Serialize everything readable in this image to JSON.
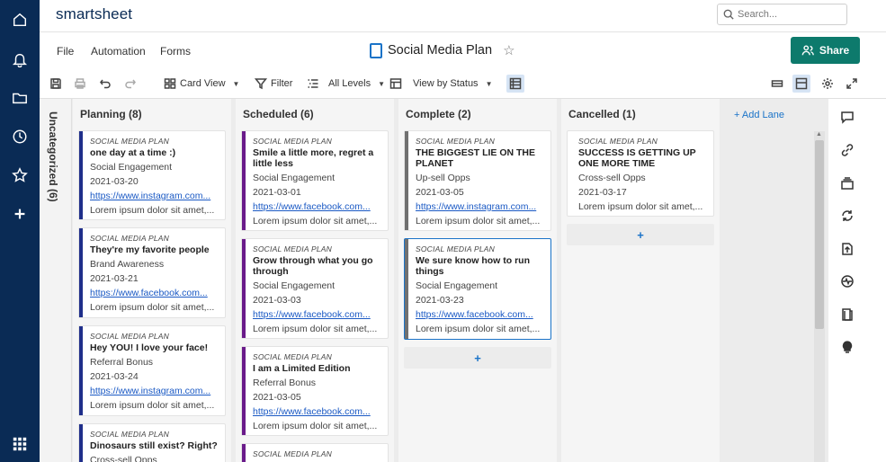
{
  "app": {
    "logo": "smartsheet",
    "search_placeholder": "Search..."
  },
  "menu": {
    "file": "File",
    "automation": "Automation",
    "forms": "Forms"
  },
  "sheet": {
    "title": "Social Media Plan"
  },
  "share_label": "Share",
  "toolbar": {
    "card_view": "Card View",
    "filter": "Filter",
    "all_levels": "All Levels",
    "view_by": "View by Status"
  },
  "board": {
    "uncategorized": "Uncategorized (6)",
    "add_lane": "+ Add Lane",
    "add_card": "+",
    "lanes": [
      {
        "title": "Planning (8)",
        "color": "#1f2f8a",
        "cards": [
          {
            "category": "SOCIAL MEDIA PLAN",
            "title": "one day at a time :)",
            "type": "Social Engagement",
            "date": "2021-03-20",
            "link": "https://www.instagram.com...",
            "notes": "Lorem ipsum dolor sit amet,..."
          },
          {
            "category": "SOCIAL MEDIA PLAN",
            "title": "They're my favorite people",
            "type": "Brand Awareness",
            "date": "2021-03-21",
            "link": "https://www.facebook.com...",
            "notes": "Lorem ipsum dolor sit amet,..."
          },
          {
            "category": "SOCIAL MEDIA PLAN",
            "title": "Hey YOU! I love your face!",
            "type": "Referral Bonus",
            "date": "2021-03-24",
            "link": "https://www.instagram.com...",
            "notes": "Lorem ipsum dolor sit amet,..."
          },
          {
            "category": "SOCIAL MEDIA PLAN",
            "title": "Dinosaurs still exist? Right?",
            "type": "Cross-sell Opps",
            "date": "",
            "link": "",
            "notes": ""
          }
        ]
      },
      {
        "title": "Scheduled (6)",
        "color": "#6a1b8a",
        "cards": [
          {
            "category": "SOCIAL MEDIA PLAN",
            "title": "Smile a little more, regret a little less",
            "type": "Social Engagement",
            "date": "2021-03-01",
            "link": "https://www.facebook.com...",
            "notes": "Lorem ipsum dolor sit amet,..."
          },
          {
            "category": "SOCIAL MEDIA PLAN",
            "title": "Grow through what you go through",
            "type": "Social Engagement",
            "date": "2021-03-03",
            "link": "https://www.facebook.com...",
            "notes": "Lorem ipsum dolor sit amet,..."
          },
          {
            "category": "SOCIAL MEDIA PLAN",
            "title": "I am a Limited Edition",
            "type": "Referral Bonus",
            "date": "2021-03-05",
            "link": "https://www.facebook.com...",
            "notes": "Lorem ipsum dolor sit amet,..."
          },
          {
            "category": "SOCIAL MEDIA PLAN",
            "title": "",
            "type": "",
            "date": "",
            "link": "",
            "notes": ""
          }
        ]
      },
      {
        "title": "Complete (2)",
        "color": "#707070",
        "cards": [
          {
            "category": "SOCIAL MEDIA PLAN",
            "title": "THE BIGGEST LIE ON THE PLANET",
            "type": "Up-sell Opps",
            "date": "2021-03-05",
            "link": "https://www.instagram.com...",
            "notes": "Lorem ipsum dolor sit amet,..."
          },
          {
            "category": "SOCIAL MEDIA PLAN",
            "title": "We sure know how to run things",
            "type": "Social Engagement",
            "date": "2021-03-23",
            "link": "https://www.facebook.com...",
            "notes": "Lorem ipsum dolor sit amet,..."
          }
        ]
      },
      {
        "title": "Cancelled (1)",
        "color": "#ffffff",
        "cards": [
          {
            "category": "SOCIAL MEDIA PLAN",
            "title": "SUCCESS IS GETTING UP ONE MORE TIME",
            "type": "Cross-sell Opps",
            "date": "2021-03-17",
            "link": "",
            "notes": "Lorem ipsum dolor sit amet,..."
          }
        ]
      }
    ]
  },
  "colors": {
    "nav": "#0a2b55",
    "accent": "#1a73c8",
    "share": "#0d7a6c"
  }
}
